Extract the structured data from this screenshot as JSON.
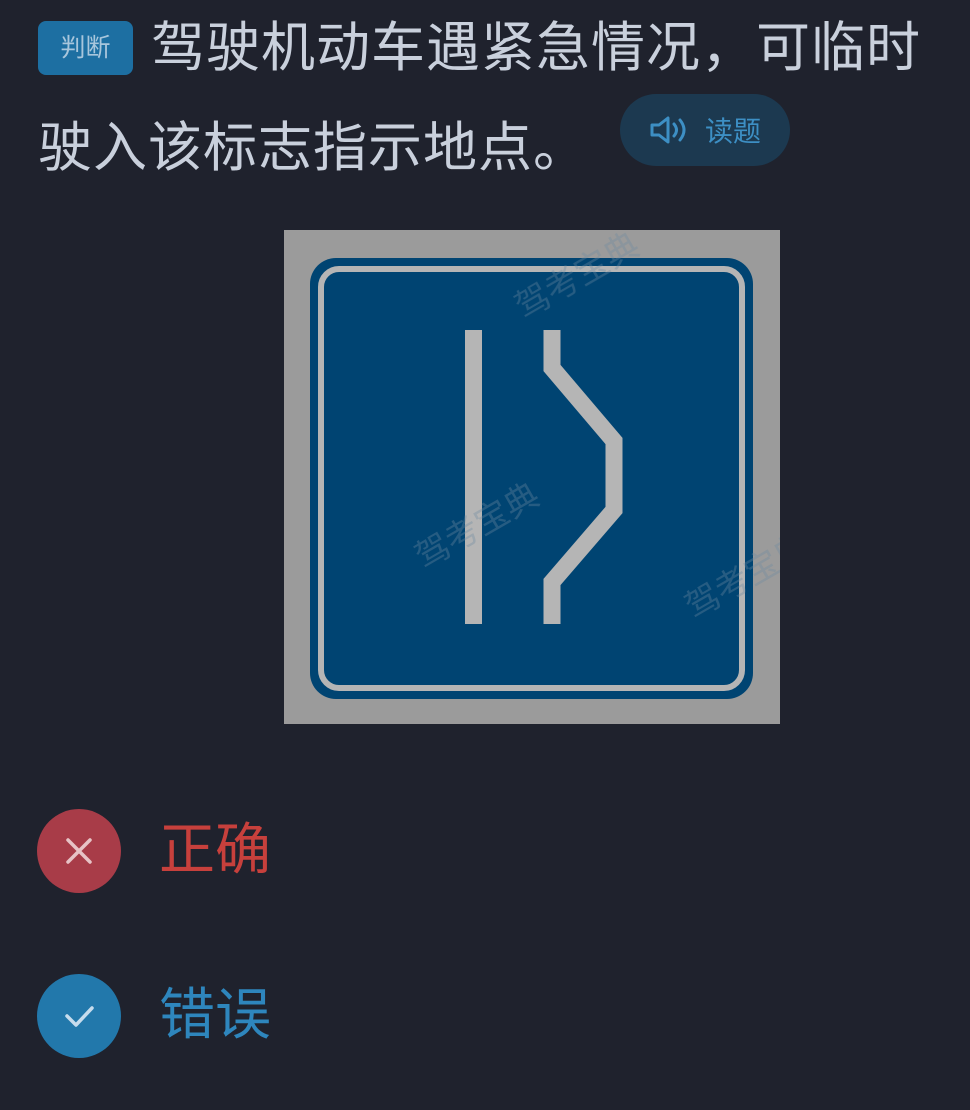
{
  "question": {
    "type_badge": "判断",
    "line1": "驾驶机动车遇紧急情况，可临时",
    "line2": "驶入该标志指示地点。",
    "read_button_label": "读题"
  },
  "sign": {
    "icon": "emergency-lane-sign",
    "watermark": "驾考宝典",
    "colors": {
      "background": "#004472",
      "symbol": "#b5b5b5",
      "frame": "#9b9b9b"
    }
  },
  "options": [
    {
      "label": "正确",
      "state": "wrong",
      "icon": "close-icon",
      "color": "#c7403c"
    },
    {
      "label": "错误",
      "state": "correct",
      "icon": "check-icon",
      "color": "#2e86bd"
    }
  ]
}
